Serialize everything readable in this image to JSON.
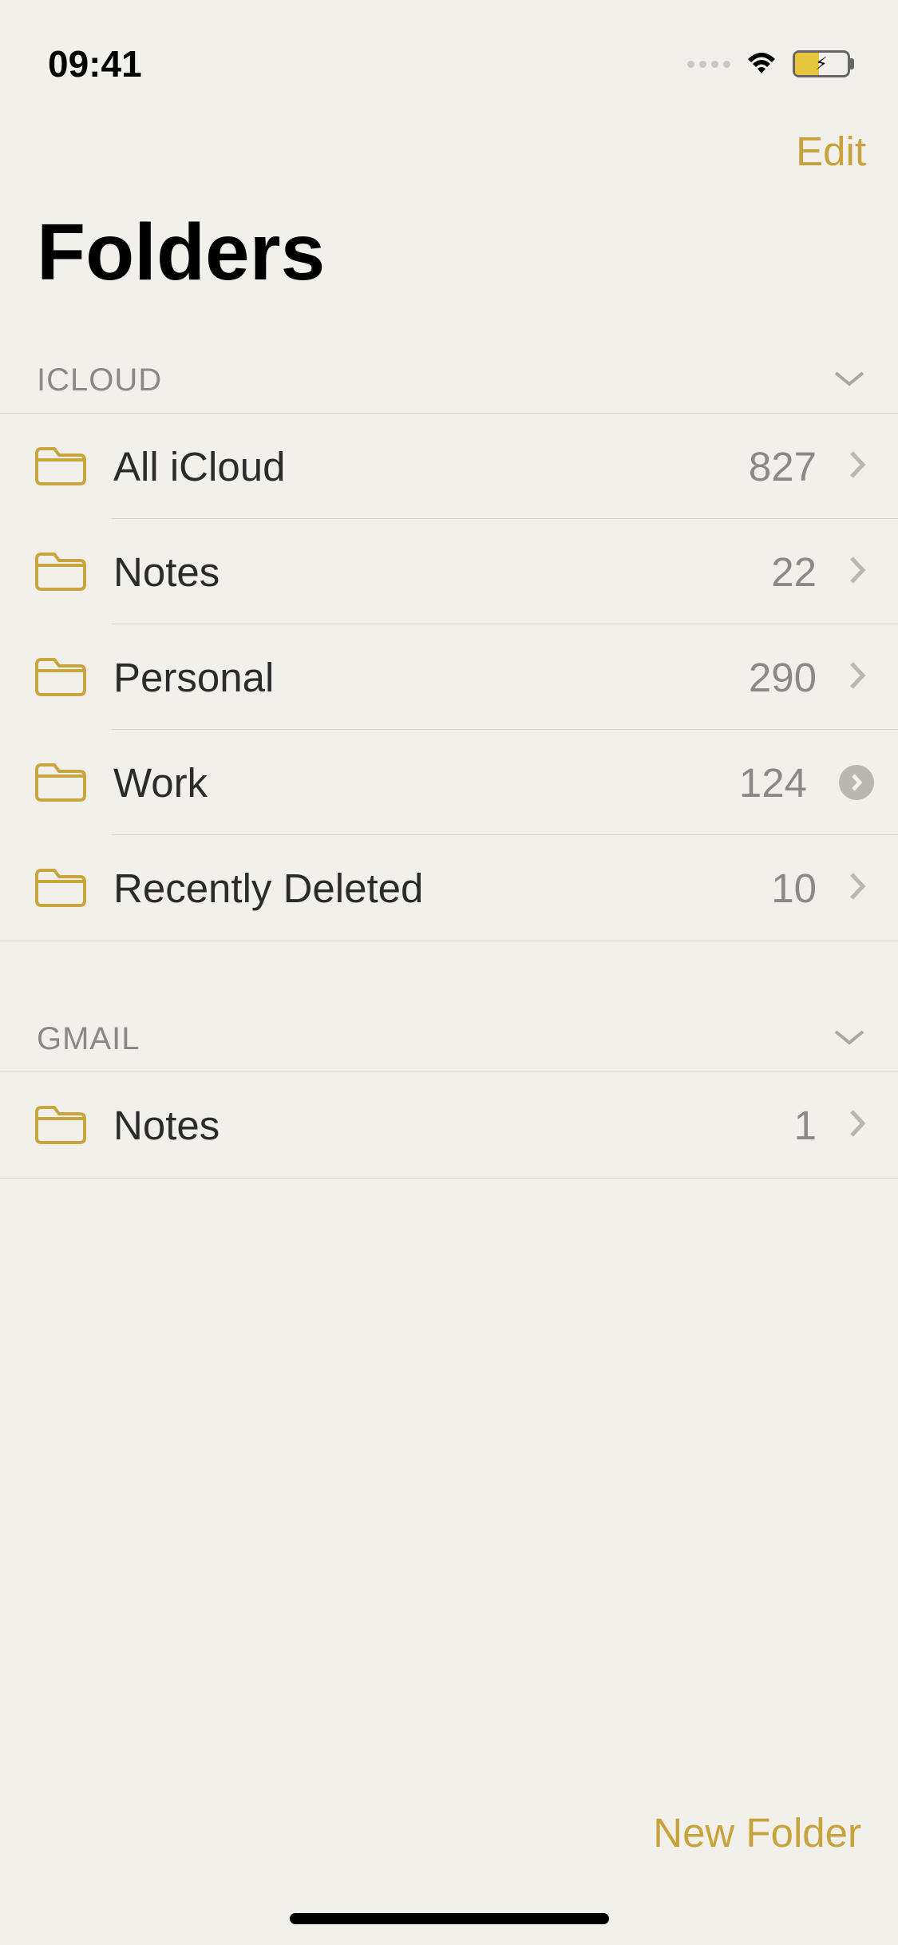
{
  "status_bar": {
    "time": "09:41"
  },
  "nav": {
    "edit_label": "Edit"
  },
  "title": "Folders",
  "sections": [
    {
      "header": "ICLOUD",
      "folders": [
        {
          "name": "All iCloud",
          "count": "827",
          "disclosure": "chevron"
        },
        {
          "name": "Notes",
          "count": "22",
          "disclosure": "chevron"
        },
        {
          "name": "Personal",
          "count": "290",
          "disclosure": "chevron"
        },
        {
          "name": "Work",
          "count": "124",
          "disclosure": "circle"
        },
        {
          "name": "Recently Deleted",
          "count": "10",
          "disclosure": "chevron"
        }
      ]
    },
    {
      "header": "GMAIL",
      "folders": [
        {
          "name": "Notes",
          "count": "1",
          "disclosure": "chevron"
        }
      ]
    }
  ],
  "toolbar": {
    "new_folder_label": "New Folder"
  },
  "colors": {
    "accent": "#c8a33b"
  }
}
